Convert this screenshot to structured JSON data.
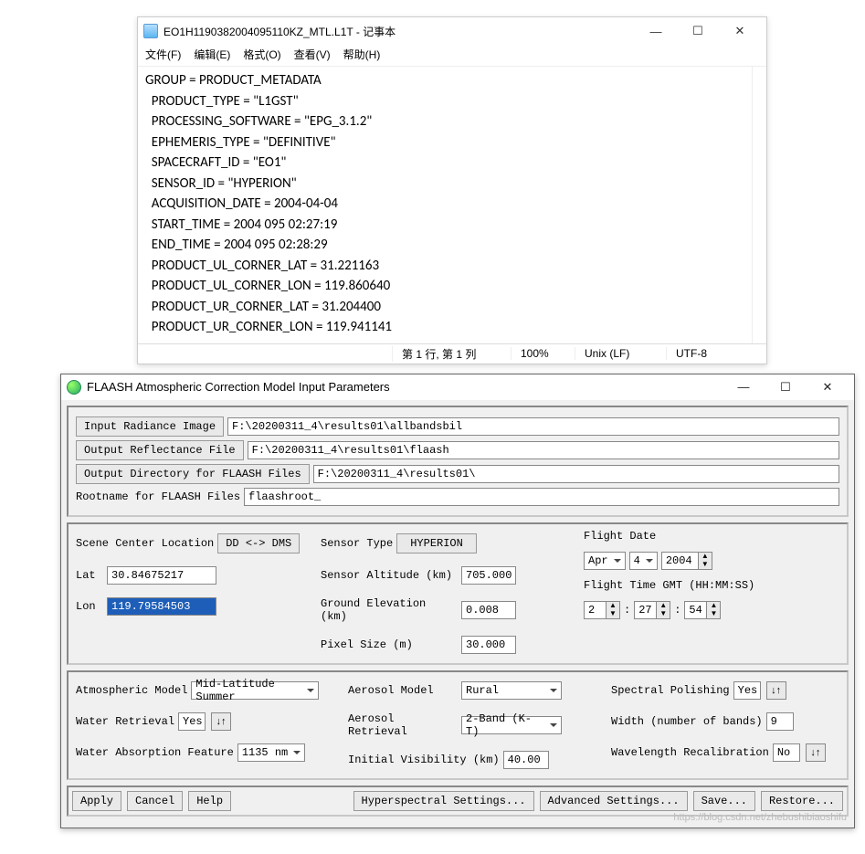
{
  "notepad": {
    "title": "EO1H1190382004095110KZ_MTL.L1T - 记事本",
    "menu": [
      "文件(F)",
      "编辑(E)",
      "格式(O)",
      "查看(V)",
      "帮助(H)"
    ],
    "content": "GROUP = PRODUCT_METADATA\n  PRODUCT_TYPE = \"L1GST\"\n  PROCESSING_SOFTWARE = \"EPG_3.1.2\"\n  EPHEMERIS_TYPE = \"DEFINITIVE\"\n  SPACECRAFT_ID = \"EO1\"\n  SENSOR_ID = \"HYPERION\"\n  ACQUISITION_DATE = 2004-04-04\n  START_TIME = 2004 095 02:27:19\n  END_TIME = 2004 095 02:28:29\n  PRODUCT_UL_CORNER_LAT = 31.221163\n  PRODUCT_UL_CORNER_LON = 119.860640\n  PRODUCT_UR_CORNER_LAT = 31.204400\n  PRODUCT_UR_CORNER_LON = 119.941141",
    "status": {
      "pos": "第 1 行, 第 1 列",
      "zoom": "100%",
      "eol": "Unix (LF)",
      "enc": "UTF-8"
    }
  },
  "flaash": {
    "title": "FLAASH Atmospheric Correction Model Input Parameters",
    "files": {
      "radiance_btn": "Input Radiance Image",
      "radiance_val": "F:\\20200311_4\\results01\\allbandsbil",
      "refl_btn": "Output Reflectance File",
      "refl_val": "F:\\20200311_4\\results01\\flaash",
      "outdir_btn": "Output Directory for FLAASH Files",
      "outdir_val": "F:\\20200311_4\\results01\\",
      "root_lbl": "Rootname for FLAASH Files",
      "root_val": "flaashroot_"
    },
    "scene": {
      "label": "Scene Center Location",
      "dd_btn": "DD <-> DMS",
      "lat_lbl": "Lat",
      "lat_val": "30.84675217",
      "lon_lbl": "Lon",
      "lon_val": "119.79584503"
    },
    "sensor": {
      "type_lbl": "Sensor Type",
      "type_btn": "HYPERION",
      "alt_lbl": "Sensor Altitude (km)",
      "alt_val": "705.000",
      "elev_lbl": "Ground Elevation (km)",
      "elev_val": "0.008",
      "pix_lbl": "Pixel Size (m)",
      "pix_val": "30.000"
    },
    "flight": {
      "date_lbl": "Flight Date",
      "month": "Apr",
      "day": "4",
      "year": "2004",
      "time_lbl": "Flight Time GMT (HH:MM:SS)",
      "hh": "2",
      "mm": "27",
      "ss": "54"
    },
    "atmo": {
      "model_lbl": "Atmospheric Model",
      "model_val": "Mid-Latitude Summer",
      "water_lbl": "Water Retrieval",
      "water_val": "Yes",
      "wabs_lbl": "Water Absorption Feature",
      "wabs_val": "1135 nm",
      "aero_model_lbl": "Aerosol Model",
      "aero_model_val": "Rural",
      "aero_ret_lbl": "Aerosol Retrieval",
      "aero_ret_val": "2-Band (K-T)",
      "vis_lbl": "Initial Visibility (km)",
      "vis_val": "40.00",
      "pol_lbl": "Spectral Polishing",
      "pol_val": "Yes",
      "width_lbl": "Width (number of bands)",
      "width_val": "9",
      "recal_lbl": "Wavelength Recalibration",
      "recal_val": "No"
    },
    "actions": {
      "apply": "Apply",
      "cancel": "Cancel",
      "help": "Help",
      "hyper": "Hyperspectral Settings...",
      "adv": "Advanced Settings...",
      "save": "Save...",
      "restore": "Restore..."
    },
    "watermark": "https://blog.csdn.net/zhebushibiaoshifu"
  }
}
